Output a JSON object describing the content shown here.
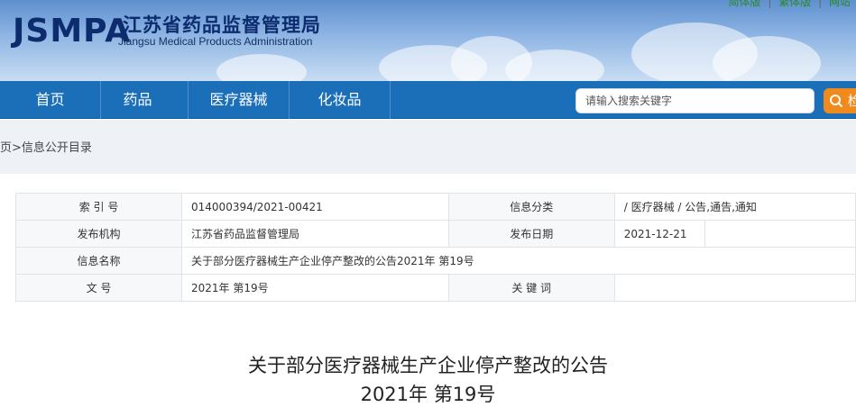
{
  "header": {
    "logo": "JSMPA",
    "org_name_cn": "江苏省药品监督管理局",
    "org_name_en": "Jiangsu Medical Products Administration",
    "top_links": [
      "简体版",
      "|",
      "繁体版",
      "|",
      "网站"
    ]
  },
  "nav": {
    "items": [
      "首页",
      "药品",
      "医疗器械",
      "化妆品"
    ]
  },
  "search": {
    "placeholder": "请输入搜索关键字",
    "button_label": "检"
  },
  "breadcrumb": "页>信息公开目录",
  "meta_table": {
    "rows": [
      {
        "l1": "索 引 号",
        "v1": "014000394/2021-00421",
        "l2": "信息分类",
        "v2": "/   医疗器械   /   公告,通告,通知"
      },
      {
        "l1": "发布机构",
        "v1": "江苏省药品监督管理局",
        "l2": "发布日期",
        "v2": "2021-12-21"
      },
      {
        "l1": "信息名称",
        "v1": "关于部分医疗器械生产企业停产整改的公告2021年 第19号"
      },
      {
        "l1": "文    号",
        "v1": "2021年 第19号",
        "l2": "关 键 词",
        "v2": ""
      }
    ]
  },
  "article": {
    "title_line1": "关于部分医疗器械生产企业停产整改的公告",
    "title_line2": "2021年 第19号"
  }
}
